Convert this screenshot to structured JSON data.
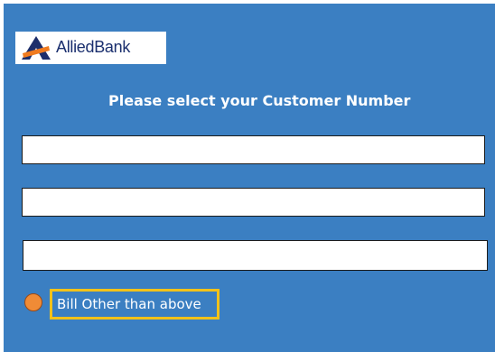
{
  "brand": {
    "name": "AlliedBank",
    "logo_icon": "allied-bank-logo-icon",
    "colors": {
      "mark_dark": "#1d2e6b",
      "mark_accent": "#f07b1f"
    }
  },
  "form": {
    "heading": "Please select your Customer Number",
    "fields": [
      {
        "value": "",
        "placeholder": ""
      },
      {
        "value": "",
        "placeholder": ""
      },
      {
        "value": "",
        "placeholder": ""
      }
    ],
    "other_option": {
      "label": "Bill Other than above",
      "selected": true,
      "highlight_color": "#f2c21a",
      "radio_color": "#f08b36"
    }
  },
  "theme": {
    "panel_bg": "#3b7fc2"
  }
}
